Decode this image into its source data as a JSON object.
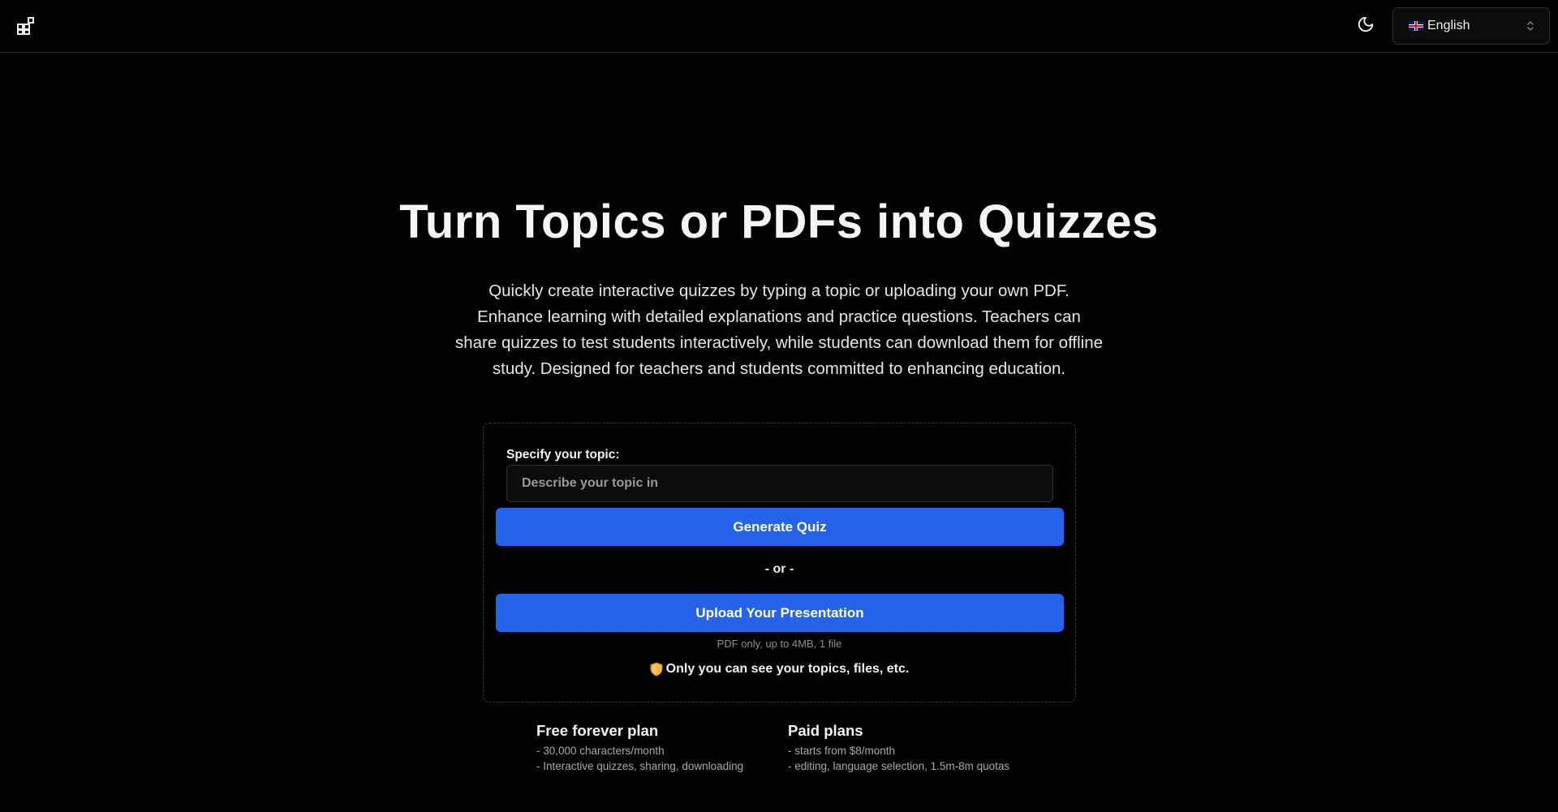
{
  "header": {
    "logo_icon": "grid-blocks-icon",
    "theme_icon": "moon-icon",
    "language": {
      "flag": "uk-flag",
      "label": "English",
      "chevron_icon": "chevron-up-down-icon"
    }
  },
  "hero": {
    "title": "Turn Topics or PDFs into Quizzes",
    "description": "Quickly create interactive quizzes by typing a topic or uploading your own PDF. Enhance learning with detailed explanations and practice questions. Teachers can share quizzes to test students interactively, while students can download them for offline study. Designed for teachers and students committed to enhancing education."
  },
  "form": {
    "topic_label": "Specify your topic:",
    "topic_value": "",
    "topic_placeholder": "Describe your topic in",
    "generate_label": "Generate Quiz",
    "or_label": "- or -",
    "upload_label": "Upload Your Presentation",
    "upload_note": "PDF only, up to 4MB, 1 file",
    "privacy_icon": "shield-icon",
    "privacy_text": "Only you can see your topics, files, etc."
  },
  "plans": {
    "free": {
      "title": "Free forever plan",
      "lines": [
        "- 30,000 characters/month",
        "- Interactive quizzes, sharing, downloading"
      ]
    },
    "paid": {
      "title": "Paid plans",
      "lines": [
        "- starts from $8/month",
        "- editing, language selection, 1.5m-8m quotas"
      ]
    }
  },
  "colors": {
    "background": "#020202",
    "accent": "#2563eb",
    "border": "#2a2a2a",
    "shield_gold": "#f4b73f"
  }
}
